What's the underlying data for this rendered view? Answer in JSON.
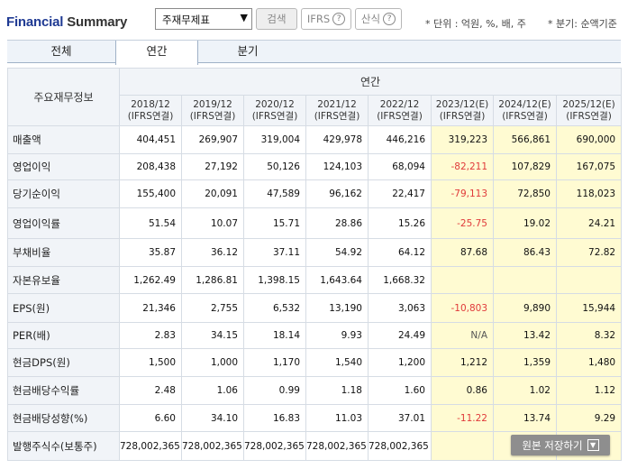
{
  "header": {
    "title_main": "Financial",
    "title_sub": "Summary",
    "select_value": "주재무제표",
    "search_label": "검색",
    "ifrs_label": "IFRS",
    "formula_label": "산식",
    "help_glyph": "?",
    "unit_note": "* 단위 : 억원, %, 배, 주",
    "period_note": "* 분기: 순액기준"
  },
  "tabs": [
    "전체",
    "연간",
    "분기"
  ],
  "table": {
    "corner_label": "주요재무정보",
    "group_label": "연간",
    "columns": [
      {
        "year": "2018/12",
        "basis": "(IFRS연결)"
      },
      {
        "year": "2019/12",
        "basis": "(IFRS연결)"
      },
      {
        "year": "2020/12",
        "basis": "(IFRS연결)"
      },
      {
        "year": "2021/12",
        "basis": "(IFRS연결)"
      },
      {
        "year": "2022/12",
        "basis": "(IFRS연결)"
      },
      {
        "year": "2023/12(E)",
        "basis": "(IFRS연결)"
      },
      {
        "year": "2024/12(E)",
        "basis": "(IFRS연결)"
      },
      {
        "year": "2025/12(E)",
        "basis": "(IFRS연결)"
      }
    ],
    "rows": [
      {
        "label": "매출액",
        "values": [
          "404,451",
          "269,907",
          "319,004",
          "429,978",
          "446,216",
          "319,223",
          "566,861",
          "690,000"
        ]
      },
      {
        "label": "영업이익",
        "values": [
          "208,438",
          "27,192",
          "50,126",
          "124,103",
          "68,094",
          "-82,211",
          "107,829",
          "167,075"
        ]
      },
      {
        "label": "당기순이익",
        "values": [
          "155,400",
          "20,091",
          "47,589",
          "96,162",
          "22,417",
          "-79,113",
          "72,850",
          "118,023"
        ]
      },
      {
        "label": "영업이익률",
        "values": [
          "51.54",
          "10.07",
          "15.71",
          "28.86",
          "15.26",
          "-25.75",
          "19.02",
          "24.21"
        ]
      },
      {
        "label": "부채비율",
        "values": [
          "35.87",
          "36.12",
          "37.11",
          "54.92",
          "64.12",
          "87.68",
          "86.43",
          "72.82"
        ]
      },
      {
        "label": "자본유보율",
        "values": [
          "1,262.49",
          "1,286.81",
          "1,398.15",
          "1,643.64",
          "1,668.32",
          "",
          "",
          ""
        ]
      },
      {
        "label": "EPS(원)",
        "values": [
          "21,346",
          "2,755",
          "6,532",
          "13,190",
          "3,063",
          "-10,803",
          "9,890",
          "15,944"
        ]
      },
      {
        "label": "PER(배)",
        "values": [
          "2.83",
          "34.15",
          "18.14",
          "9.93",
          "24.49",
          "N/A",
          "13.42",
          "8.32"
        ]
      },
      {
        "label": "현금DPS(원)",
        "values": [
          "1,500",
          "1,000",
          "1,170",
          "1,540",
          "1,200",
          "1,212",
          "1,359",
          "1,480"
        ]
      },
      {
        "label": "현금배당수익률",
        "values": [
          "2.48",
          "1.06",
          "0.99",
          "1.18",
          "1.60",
          "0.86",
          "1.02",
          "1.12"
        ]
      },
      {
        "label": "현금배당성향(%)",
        "values": [
          "6.60",
          "34.10",
          "16.83",
          "11.03",
          "37.01",
          "-11.22",
          "13.74",
          "9.29"
        ]
      },
      {
        "label": "발행주식수(보통주)",
        "values": [
          "728,002,365",
          "728,002,365",
          "728,002,365",
          "728,002,365",
          "728,002,365",
          "",
          "",
          ""
        ]
      }
    ]
  },
  "save_button_label": "원본 저장하기",
  "colors": {
    "title_blue": "#1f3a93",
    "estimate_bg": "#fffbd2",
    "negative": "#e03a3a",
    "header_bg": "#f1f4f8"
  }
}
